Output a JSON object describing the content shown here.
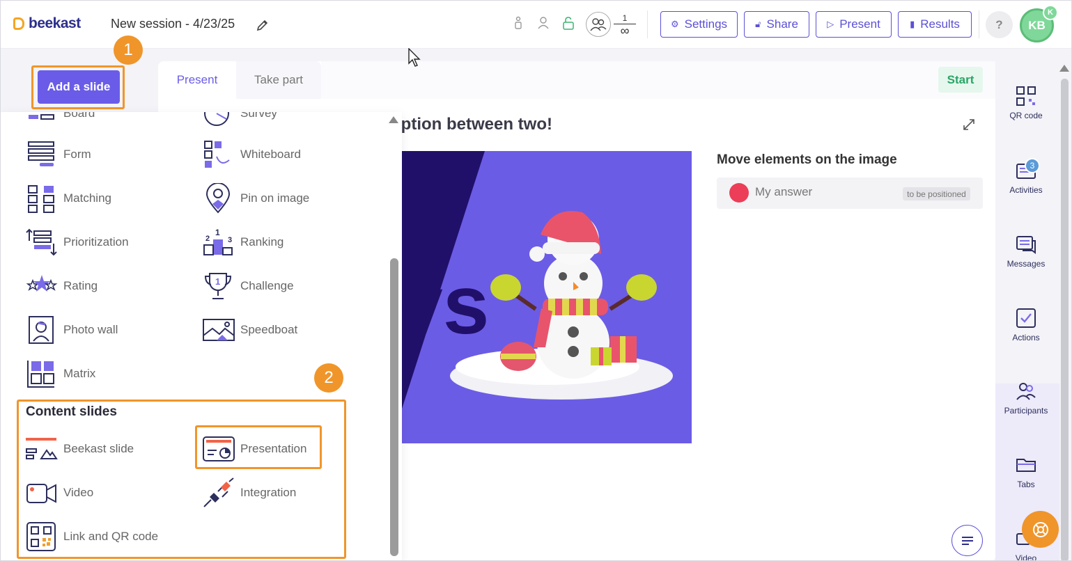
{
  "header": {
    "logo_text": "beekast",
    "session_title": "New session - 4/23/25",
    "counter_top": "1",
    "counter_bottom": "∞",
    "buttons": {
      "settings": "Settings",
      "share": "Share",
      "present": "Present",
      "results": "Results"
    },
    "help_label": "?",
    "avatar_initials": "KB",
    "avatar_badge": "K"
  },
  "annotations": {
    "step1": "1",
    "step2": "2"
  },
  "sidebar_left": {
    "add_slide_label": "Add a slide"
  },
  "panel": {
    "interactive_types": [
      {
        "label": "Board",
        "icon": "board-icon"
      },
      {
        "label": "Survey",
        "icon": "survey-icon"
      },
      {
        "label": "Form",
        "icon": "form-icon"
      },
      {
        "label": "Whiteboard",
        "icon": "whiteboard-icon"
      },
      {
        "label": "Matching",
        "icon": "matching-icon"
      },
      {
        "label": "Pin on image",
        "icon": "pin-icon"
      },
      {
        "label": "Prioritization",
        "icon": "prioritization-icon"
      },
      {
        "label": "Ranking",
        "icon": "ranking-icon"
      },
      {
        "label": "Rating",
        "icon": "rating-icon"
      },
      {
        "label": "Challenge",
        "icon": "trophy-icon"
      },
      {
        "label": "Photo wall",
        "icon": "photo-wall-icon"
      },
      {
        "label": "Speedboat",
        "icon": "speedboat-icon"
      },
      {
        "label": "Matrix",
        "icon": "matrix-icon"
      }
    ],
    "content_section_title": "Content slides",
    "content_types": [
      {
        "label": "Beekast slide",
        "icon": "beekast-slide-icon"
      },
      {
        "label": "Presentation",
        "icon": "presentation-icon"
      },
      {
        "label": "Video",
        "icon": "video-icon"
      },
      {
        "label": "Integration",
        "icon": "plug-icon"
      },
      {
        "label": "Link and QR code",
        "icon": "qr-link-icon"
      }
    ]
  },
  "main": {
    "tabs": [
      {
        "label": "Present"
      },
      {
        "label": "Take part"
      }
    ],
    "start_label": "Start",
    "question_title": "option between two!",
    "slide_image_text": "vs",
    "move_title": "Move elements on the image",
    "answer_text": "My answer",
    "answer_badge": "to be positioned"
  },
  "sidebar_right": {
    "items": [
      {
        "label": "QR code",
        "icon": "qr-code-icon"
      },
      {
        "label": "Activities",
        "icon": "activities-icon",
        "badge": "3"
      },
      {
        "label": "Messages",
        "icon": "messages-icon"
      },
      {
        "label": "Actions",
        "icon": "checkbox-icon"
      },
      {
        "label": "Participants",
        "icon": "participants-icon"
      },
      {
        "label": "Tabs",
        "icon": "folder-icon"
      },
      {
        "label": "Video",
        "icon": "video-icon"
      }
    ]
  },
  "colors": {
    "brand_purple": "#6a5ce8",
    "highlight_orange": "#f0952a",
    "answer_red": "#ec3e58",
    "start_green": "#2aa566"
  }
}
